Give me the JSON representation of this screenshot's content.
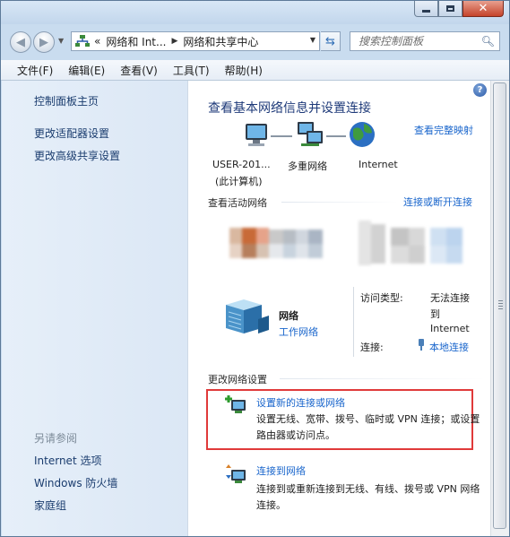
{
  "window": {
    "caption_close": "✕"
  },
  "address": {
    "overflow": "«",
    "segments": [
      "网络和 Int...",
      "网络和共享中心"
    ]
  },
  "search": {
    "placeholder": "搜索控制面板"
  },
  "menu": [
    "文件(F)",
    "编辑(E)",
    "查看(V)",
    "工具(T)",
    "帮助(H)"
  ],
  "sidebar": {
    "links": [
      "控制面板主页",
      "更改适配器设置",
      "更改高级共享设置"
    ],
    "see_also_label": "另请参阅",
    "see_also": [
      "Internet 选项",
      "Windows 防火墙",
      "家庭组"
    ]
  },
  "main": {
    "help": "?",
    "title": "查看基本网络信息并设置连接",
    "full_map": "查看完整映射",
    "nodes": {
      "computer_line1": "USER-201...",
      "computer_line2": "(此计算机)",
      "multi": "多重网络",
      "internet": "Internet"
    },
    "active_section": "查看活动网络",
    "connect_disconnect": "连接或断开连接",
    "network": {
      "name": "网络",
      "type": "工作网络",
      "access_label": "访问类型:",
      "access_value_1": "无法连接",
      "access_value_2": "到",
      "access_value_3": "Internet",
      "conn_label": "连接:",
      "conn_value": "本地连接"
    },
    "change_section": "更改网络设置",
    "tasks": [
      {
        "title": "设置新的连接或网络",
        "desc": "设置无线、宽带、拨号、临时或 VPN 连接；或设置路由器或访问点。"
      },
      {
        "title": "连接到网络",
        "desc": "连接到或重新连接到无线、有线、拨号或 VPN 网络连接。"
      }
    ]
  },
  "colors": {
    "link": "#1a66cc",
    "title": "#1e3a79",
    "highlight_box": "#e03a3a"
  }
}
